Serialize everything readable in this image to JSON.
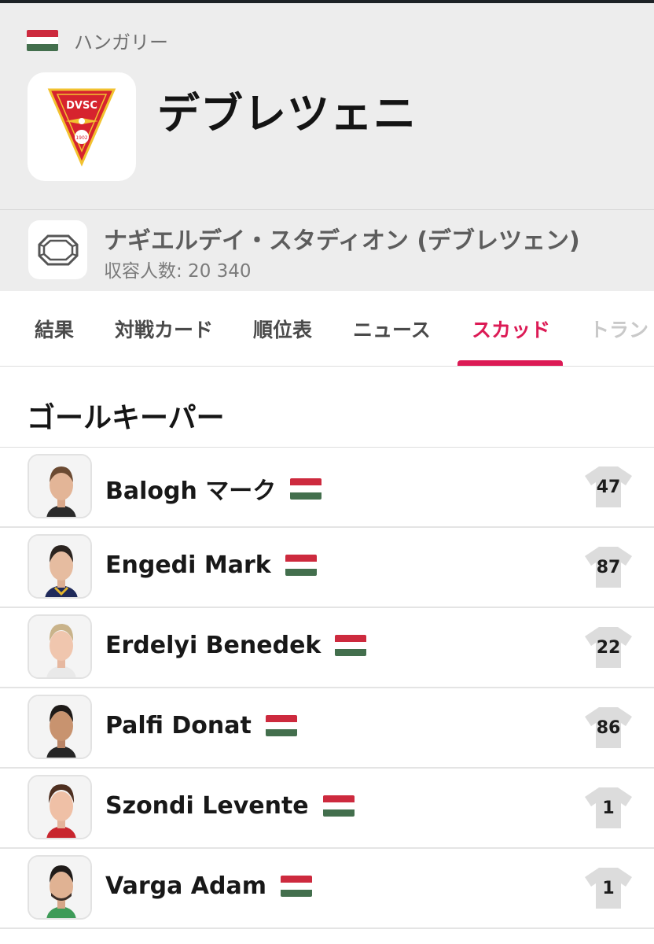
{
  "country": {
    "name": "ハンガリー",
    "flag": "hungary"
  },
  "team": {
    "name": "デブレツェニ",
    "logo": {
      "text": "DVSC",
      "year": "1902",
      "colors": {
        "red": "#d6232e",
        "yellow": "#f2c230"
      }
    }
  },
  "stadium": {
    "name": "ナギエルデイ・スタディオン (デブレツェン)",
    "capacity": "収容人数: 20 340",
    "icon": "stadium-icon"
  },
  "tabs": [
    {
      "label": "結果",
      "active": false
    },
    {
      "label": "対戦カード",
      "active": false
    },
    {
      "label": "順位表",
      "active": false
    },
    {
      "label": "ニュース",
      "active": false
    },
    {
      "label": "スカッド",
      "active": true
    },
    {
      "label": "トラン",
      "active": false
    }
  ],
  "colors": {
    "accent": "#dc1a55",
    "header_bg": "#ededed",
    "flag_red": "#cd2a3e",
    "flag_green": "#436f4d"
  },
  "section": {
    "title": "ゴールキーパー"
  },
  "players": [
    {
      "name": "Balogh マーク",
      "number": "47",
      "nationality": "hungary"
    },
    {
      "name": "Engedi Mark",
      "number": "87",
      "nationality": "hungary"
    },
    {
      "name": "Erdelyi Benedek",
      "number": "22",
      "nationality": "hungary"
    },
    {
      "name": "Palfi Donat",
      "number": "86",
      "nationality": "hungary"
    },
    {
      "name": "Szondi Levente",
      "number": "1",
      "nationality": "hungary"
    },
    {
      "name": "Varga Adam",
      "number": "1",
      "nationality": "hungary"
    }
  ]
}
